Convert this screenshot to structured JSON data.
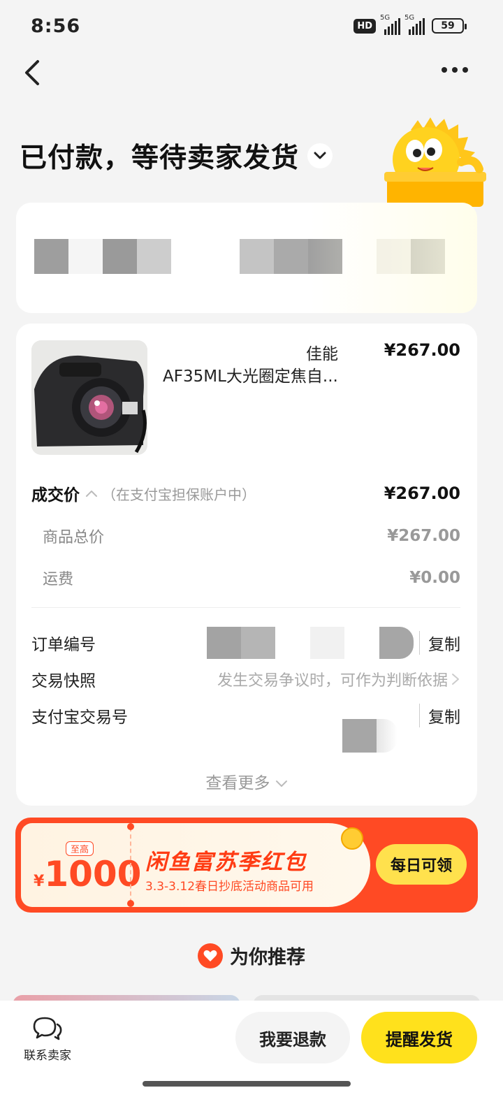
{
  "status_bar": {
    "time": "8:56",
    "hd": "HD",
    "net1": "5G",
    "net2": "5G",
    "battery": "59"
  },
  "header": {
    "status_title": "已付款，等待卖家发货"
  },
  "product": {
    "brand": "佳能",
    "title": "AF35ML大光圈定焦自...",
    "price": "¥267.00"
  },
  "price_detail": {
    "deal_label": "成交价",
    "deal_note": "（在支付宝担保账户中）",
    "deal_value": "¥267.00",
    "items": [
      {
        "label": "商品总价",
        "value": "¥267.00"
      },
      {
        "label": "运费",
        "value": "¥0.00"
      }
    ]
  },
  "order_info": {
    "order_no_label": "订单编号",
    "copy_label": "复制",
    "snapshot_label": "交易快照",
    "snapshot_hint": "发生交易争议时，可作为判断依据",
    "alipay_label": "支付宝交易号",
    "see_more": "查看更多"
  },
  "coupon": {
    "top_tag": "至高",
    "currency": "¥",
    "amount": "1000",
    "title": "闲鱼富苏季红包",
    "subtitle": "3.3-3.12春日抄底活动商品可用",
    "button": "每日可领"
  },
  "recommend": {
    "title": "为你推荐"
  },
  "bottom_bar": {
    "contact_label": "联系卖家",
    "refund_label": "我要退款",
    "remind_label": "提醒发货"
  },
  "colors": {
    "accent_yellow": "#ffe11c",
    "accent_red": "#ff4a24"
  }
}
